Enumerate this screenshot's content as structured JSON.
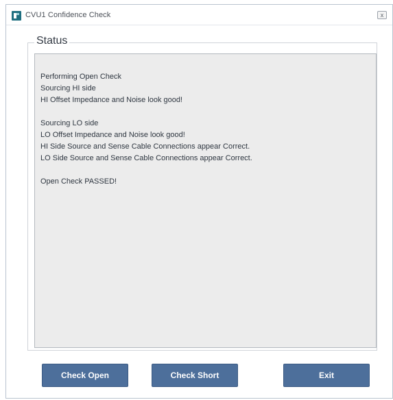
{
  "window": {
    "title": "CVU1 Confidence Check",
    "close_label": "x"
  },
  "status": {
    "legend": "Status",
    "lines": [
      "Performing Open Check",
      "Sourcing HI side",
      "HI Offset Impedance and Noise look good!",
      "",
      "Sourcing LO side",
      "LO Offset Impedance and Noise look good!",
      "HI Side Source and Sense Cable Connections appear Correct.",
      "LO Side Source and Sense Cable Connections appear Correct.",
      "",
      "Open Check PASSED!"
    ]
  },
  "buttons": {
    "check_open": "Check Open",
    "check_short": "Check Short",
    "exit": "Exit"
  },
  "colors": {
    "button_fill": "#4d6f9b",
    "panel_fill": "#ececec",
    "app_icon": "#1f6f80"
  }
}
